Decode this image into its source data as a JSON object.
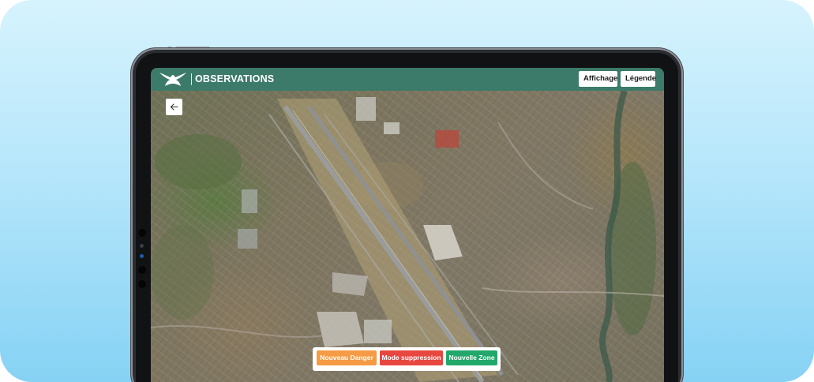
{
  "header": {
    "title": "OBSERVATIONS",
    "buttons": {
      "affichage": "Affichage",
      "legende": "Légende"
    }
  },
  "map": {
    "back_icon": "arrow-left-icon",
    "map_type": "satellite"
  },
  "actions": {
    "new_danger": "Nouveau Danger",
    "delete_mode": "Mode suppression",
    "new_zone": "Nouvelle Zone"
  },
  "colors": {
    "header_bg": "#3c7a69",
    "danger": "#f59a45",
    "delete": "#e8473f",
    "zone": "#21a86a",
    "background_top": "#d6f3fd",
    "background_bottom": "#86d2f4"
  }
}
